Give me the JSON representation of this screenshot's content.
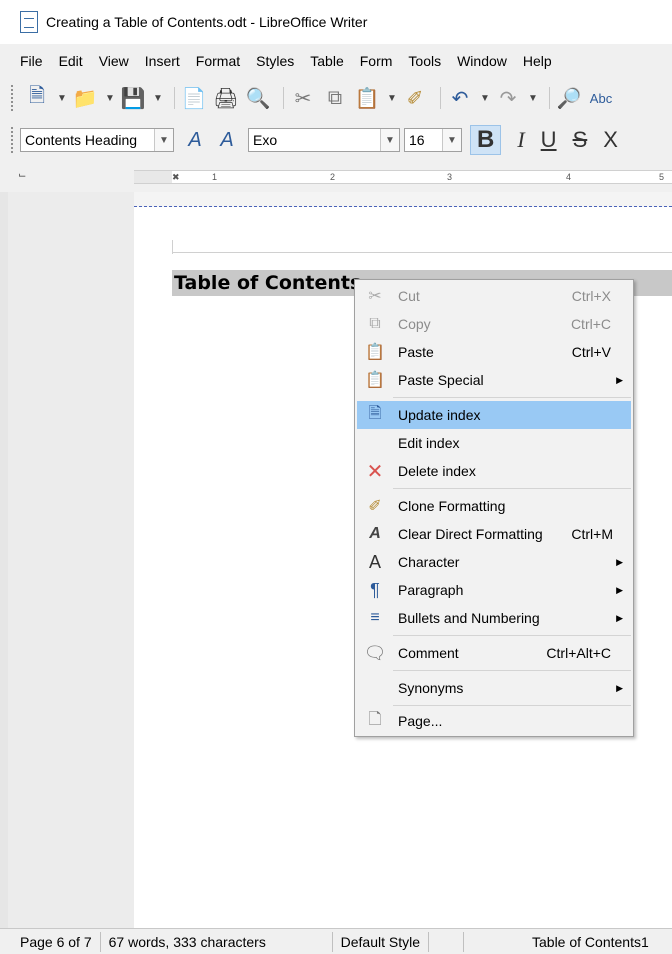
{
  "window": {
    "title": "Creating a Table of Contents.odt - LibreOffice Writer"
  },
  "menubar": [
    "File",
    "Edit",
    "View",
    "Insert",
    "Format",
    "Styles",
    "Table",
    "Form",
    "Tools",
    "Window",
    "Help"
  ],
  "toolbar2": {
    "paragraph_style": "Contents Heading",
    "font_name": "Exo",
    "font_size": "16",
    "bold": "B",
    "italic": "I",
    "underline": "U",
    "strike": "S",
    "clear": "X"
  },
  "ruler": {
    "ticks": [
      "1",
      "2",
      "3",
      "4",
      "5"
    ]
  },
  "document": {
    "heading": "Table of Contents"
  },
  "context_menu": {
    "items": [
      {
        "label": "Cut",
        "shortcut": "Ctrl+X",
        "icon": "scissors-icon",
        "enabled": false
      },
      {
        "label": "Copy",
        "shortcut": "Ctrl+C",
        "icon": "copy-icon",
        "enabled": false
      },
      {
        "label": "Paste",
        "shortcut": "Ctrl+V",
        "icon": "paste-icon",
        "enabled": true
      },
      {
        "label": "Paste Special",
        "shortcut": "",
        "icon": "paste-special-icon",
        "enabled": true,
        "submenu": true
      },
      {
        "label": "Update index",
        "shortcut": "",
        "icon": "update-index-icon",
        "enabled": true,
        "highlighted": true
      },
      {
        "label": "Edit index",
        "shortcut": "",
        "icon": "",
        "enabled": true
      },
      {
        "label": "Delete index",
        "shortcut": "",
        "icon": "delete-icon",
        "enabled": true
      },
      {
        "label": "Clone Formatting",
        "shortcut": "",
        "icon": "paintbrush-icon",
        "enabled": true
      },
      {
        "label": "Clear Direct Formatting",
        "shortcut": "Ctrl+M",
        "icon": "clear-formatting-icon",
        "enabled": true
      },
      {
        "label": "Character",
        "shortcut": "",
        "icon": "character-icon",
        "enabled": true,
        "submenu": true
      },
      {
        "label": "Paragraph",
        "shortcut": "",
        "icon": "paragraph-icon",
        "enabled": true,
        "submenu": true
      },
      {
        "label": "Bullets and Numbering",
        "shortcut": "",
        "icon": "bullets-icon",
        "enabled": true,
        "submenu": true
      },
      {
        "label": "Comment",
        "shortcut": "Ctrl+Alt+C",
        "icon": "comment-icon",
        "enabled": true
      },
      {
        "label": "Synonyms",
        "shortcut": "",
        "icon": "",
        "enabled": true,
        "submenu": true
      },
      {
        "label": "Page...",
        "shortcut": "",
        "icon": "page-icon",
        "enabled": true
      }
    ]
  },
  "statusbar": {
    "page": "Page 6 of 7",
    "words": "67 words, 333 characters",
    "style": "Default Style",
    "section": "Table of Contents1"
  },
  "colors": {
    "highlight": "#99c9f4",
    "heading_bg": "#c8c8c8",
    "delete_red": "#d9534f"
  }
}
